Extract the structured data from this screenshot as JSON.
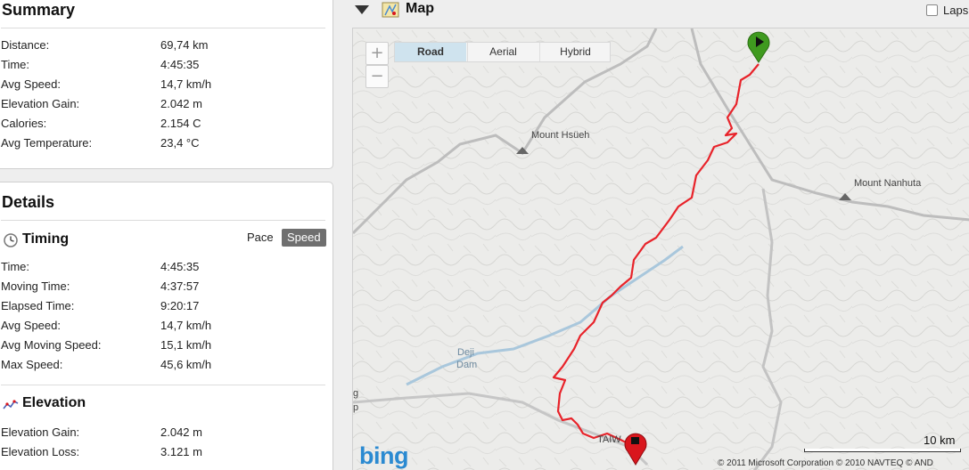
{
  "summary": {
    "title": "Summary",
    "rows": [
      {
        "label": "Distance:",
        "value": "69,74 km"
      },
      {
        "label": "Time:",
        "value": "4:45:35"
      },
      {
        "label": "Avg Speed:",
        "value": "14,7 km/h"
      },
      {
        "label": "Elevation Gain:",
        "value": "2.042 m"
      },
      {
        "label": "Calories:",
        "value": "2.154 C"
      },
      {
        "label": "Avg Temperature:",
        "value": "23,4 °C"
      }
    ]
  },
  "details": {
    "title": "Details",
    "timing": {
      "heading": "Timing",
      "icon": "clock-icon",
      "toggle": {
        "pace_label": "Pace",
        "speed_label": "Speed",
        "selected": "Speed"
      },
      "rows": [
        {
          "label": "Time:",
          "value": "4:45:35"
        },
        {
          "label": "Moving Time:",
          "value": "4:37:57"
        },
        {
          "label": "Elapsed Time:",
          "value": "9:20:17"
        },
        {
          "label": "Avg Speed:",
          "value": "14,7 km/h"
        },
        {
          "label": "Avg Moving Speed:",
          "value": "15,1 km/h"
        },
        {
          "label": "Max Speed:",
          "value": "45,6 km/h"
        }
      ]
    },
    "elevation": {
      "heading": "Elevation",
      "icon": "elevation-chart-icon",
      "rows": [
        {
          "label": "Elevation Gain:",
          "value": "2.042 m"
        },
        {
          "label": "Elevation Loss:",
          "value": "3.121 m"
        }
      ]
    }
  },
  "map": {
    "title": "Map",
    "laps_label": "Laps",
    "laps_checked": false,
    "map_types": [
      {
        "label": "Road",
        "selected": true
      },
      {
        "label": "Aerial",
        "selected": false
      },
      {
        "label": "Hybrid",
        "selected": false
      }
    ],
    "zoom_in_label": "+",
    "zoom_out_label": "−",
    "labels": {
      "mount_hsueh": "Mount Hsüeh",
      "mount_nanhuta": "Mount Nanhuta",
      "deji": "Deji",
      "dam": "Dam",
      "taiwan": "TAIW",
      "edge_g": "g",
      "edge_p": "p"
    },
    "brand": "bing",
    "scale_label": "10 km",
    "copyright": "© 2011 Microsoft Corporation   © 2010 NAVTEQ   © AND",
    "colors": {
      "route": "#e8232a",
      "start_pin": "#3f9a1f",
      "end_pin": "#d9161d",
      "water": "#a9c7dc",
      "brand": "#2b8ad1"
    }
  }
}
